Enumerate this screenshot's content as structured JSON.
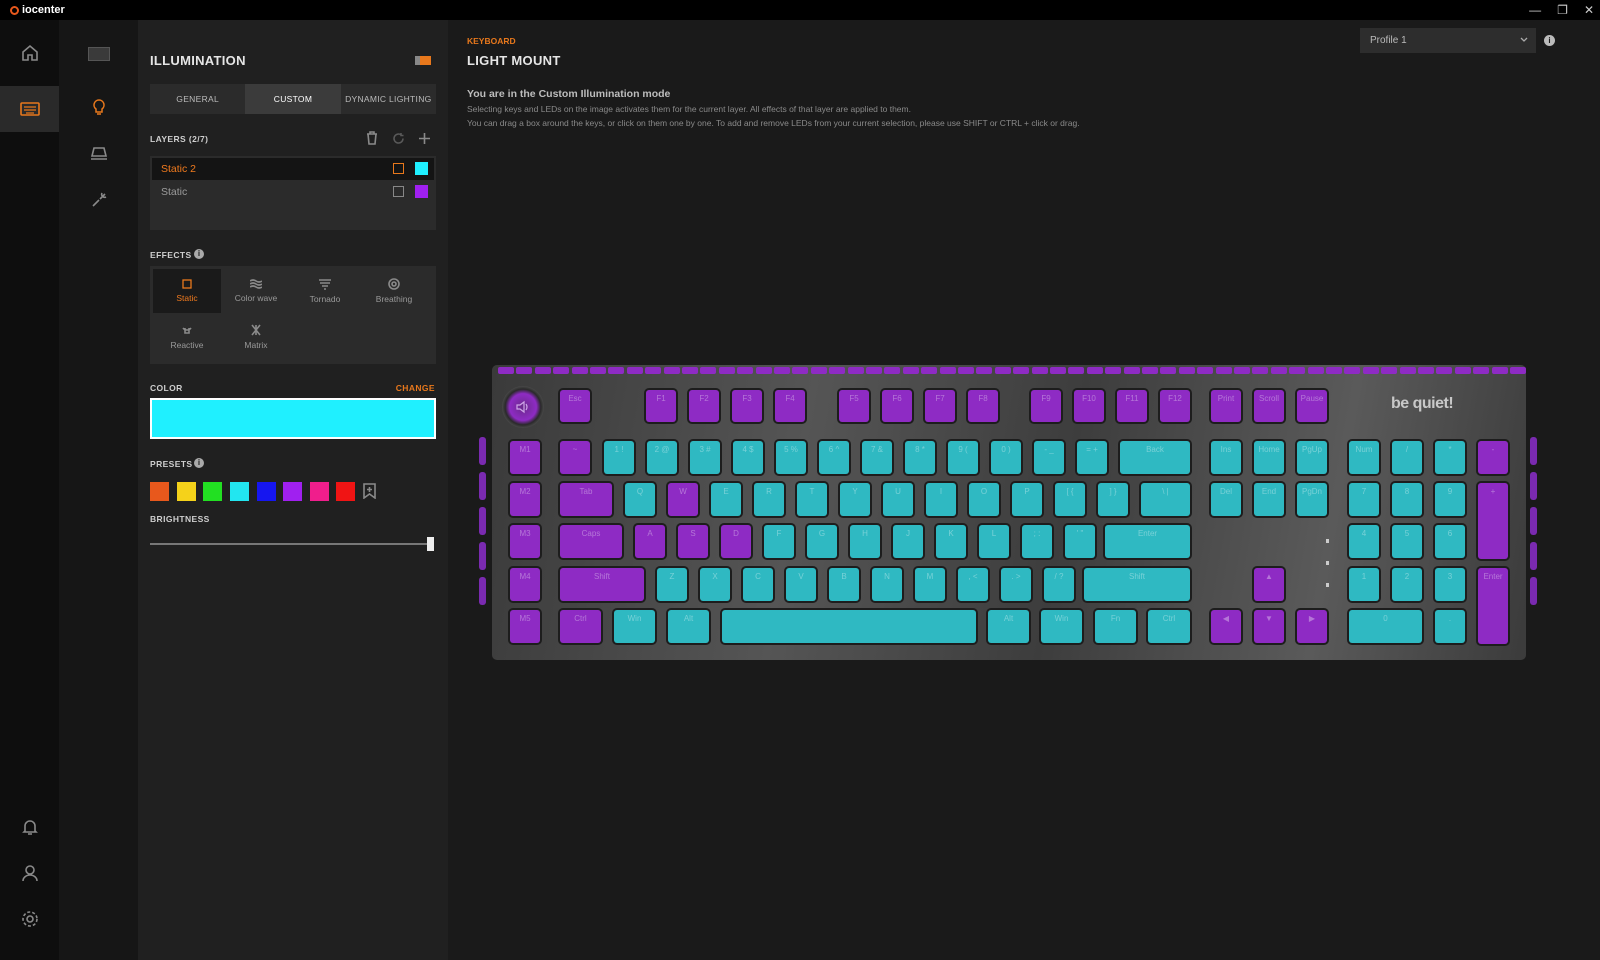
{
  "app": {
    "name": "iocenter"
  },
  "window_controls": {
    "minimize": "—",
    "restore": "❐",
    "close": "✕"
  },
  "panel": {
    "title": "ILLUMINATION",
    "tabs": [
      {
        "label": "GENERAL"
      },
      {
        "label": "CUSTOM"
      },
      {
        "label": "DYNAMIC LIGHTING"
      }
    ],
    "layers_label": "LAYERS (2/7)",
    "layers": [
      {
        "name": "Static 2",
        "color": "#1ff0ff"
      },
      {
        "name": "Static",
        "color": "#a020f0"
      }
    ],
    "effects_label": "EFFECTS",
    "effects": [
      {
        "label": "Static"
      },
      {
        "label": "Color wave"
      },
      {
        "label": "Tornado"
      },
      {
        "label": "Breathing"
      },
      {
        "label": "Reactive"
      },
      {
        "label": "Matrix"
      }
    ],
    "color_label": "COLOR",
    "change_label": "CHANGE",
    "current_color": "#1ff0ff",
    "presets_label": "PRESETS",
    "presets": [
      "#e8581c",
      "#f5d21a",
      "#22e022",
      "#22e6f0",
      "#1616f0",
      "#a020f0",
      "#f01e8c",
      "#f01414"
    ],
    "brightness_label": "BRIGHTNESS",
    "brightness": 1.0
  },
  "main": {
    "breadcrumb": "KEYBOARD",
    "title": "LIGHT MOUNT",
    "profile": "Profile 1",
    "info_heading": "You are in the Custom Illumination mode",
    "info_line1": "Selecting keys and LEDs on the image activates them for the current layer. All effects of that layer are applied to them.",
    "info_line2": "You can drag a box around the keys, or click on them one by one. To add and remove LEDs from your current selection, please use SHIFT or CTRL + click or drag."
  },
  "keyboard": {
    "brand": "be quiet!",
    "colors": {
      "cyan": "#2fb9c2",
      "purple": "#8e2bc4"
    },
    "keys": [
      {
        "l": "Esc",
        "c": "p"
      },
      {
        "l": "F1",
        "c": "p"
      },
      {
        "l": "F2",
        "c": "p"
      },
      {
        "l": "F3",
        "c": "p"
      },
      {
        "l": "F4",
        "c": "p"
      },
      {
        "l": "F5",
        "c": "p"
      },
      {
        "l": "F6",
        "c": "p"
      },
      {
        "l": "F7",
        "c": "p"
      },
      {
        "l": "F8",
        "c": "p"
      },
      {
        "l": "F9",
        "c": "p"
      },
      {
        "l": "F10",
        "c": "p"
      },
      {
        "l": "F11",
        "c": "p"
      },
      {
        "l": "F12",
        "c": "p"
      },
      {
        "l": "Print",
        "c": "p"
      },
      {
        "l": "Scroll",
        "c": "p"
      },
      {
        "l": "Pause",
        "c": "p"
      },
      {
        "l": "M1",
        "c": "p"
      },
      {
        "l": "~",
        "c": "p"
      },
      {
        "l": "1 !",
        "c": "c"
      },
      {
        "l": "2 @",
        "c": "c"
      },
      {
        "l": "3 #",
        "c": "c"
      },
      {
        "l": "4 $",
        "c": "c"
      },
      {
        "l": "5 %",
        "c": "c"
      },
      {
        "l": "6 ^",
        "c": "c"
      },
      {
        "l": "7 &",
        "c": "c"
      },
      {
        "l": "8 *",
        "c": "c"
      },
      {
        "l": "9 (",
        "c": "c"
      },
      {
        "l": "0 )",
        "c": "c"
      },
      {
        "l": "- _",
        "c": "c"
      },
      {
        "l": "= +",
        "c": "c"
      },
      {
        "l": "Back",
        "c": "c"
      },
      {
        "l": "Ins",
        "c": "c"
      },
      {
        "l": "Home",
        "c": "c"
      },
      {
        "l": "PgUp",
        "c": "c"
      },
      {
        "l": "Num",
        "c": "c"
      },
      {
        "l": "/",
        "c": "c"
      },
      {
        "l": "*",
        "c": "c"
      },
      {
        "l": "-",
        "c": "p"
      },
      {
        "l": "M2",
        "c": "p"
      },
      {
        "l": "Tab",
        "c": "p"
      },
      {
        "l": "Q",
        "c": "c"
      },
      {
        "l": "W",
        "c": "p"
      },
      {
        "l": "E",
        "c": "c"
      },
      {
        "l": "R",
        "c": "c"
      },
      {
        "l": "T",
        "c": "c"
      },
      {
        "l": "Y",
        "c": "c"
      },
      {
        "l": "U",
        "c": "c"
      },
      {
        "l": "I",
        "c": "c"
      },
      {
        "l": "O",
        "c": "c"
      },
      {
        "l": "P",
        "c": "c"
      },
      {
        "l": "[ {",
        "c": "c"
      },
      {
        "l": "] }",
        "c": "c"
      },
      {
        "l": "\\ |",
        "c": "c"
      },
      {
        "l": "Del",
        "c": "c"
      },
      {
        "l": "End",
        "c": "c"
      },
      {
        "l": "PgDn",
        "c": "c"
      },
      {
        "l": "7",
        "c": "c"
      },
      {
        "l": "8",
        "c": "c"
      },
      {
        "l": "9",
        "c": "c"
      },
      {
        "l": "+",
        "c": "p"
      },
      {
        "l": "M3",
        "c": "p"
      },
      {
        "l": "Caps",
        "c": "p"
      },
      {
        "l": "A",
        "c": "p"
      },
      {
        "l": "S",
        "c": "p"
      },
      {
        "l": "D",
        "c": "p"
      },
      {
        "l": "F",
        "c": "c"
      },
      {
        "l": "G",
        "c": "c"
      },
      {
        "l": "H",
        "c": "c"
      },
      {
        "l": "J",
        "c": "c"
      },
      {
        "l": "K",
        "c": "c"
      },
      {
        "l": "L",
        "c": "c"
      },
      {
        "l": "; :",
        "c": "c"
      },
      {
        "l": "' \"",
        "c": "c"
      },
      {
        "l": "Enter",
        "c": "c"
      },
      {
        "l": "4",
        "c": "c"
      },
      {
        "l": "5",
        "c": "c"
      },
      {
        "l": "6",
        "c": "c"
      },
      {
        "l": "M4",
        "c": "p"
      },
      {
        "l": "Shift",
        "c": "p"
      },
      {
        "l": "Z",
        "c": "c"
      },
      {
        "l": "X",
        "c": "c"
      },
      {
        "l": "C",
        "c": "c"
      },
      {
        "l": "V",
        "c": "c"
      },
      {
        "l": "B",
        "c": "c"
      },
      {
        "l": "N",
        "c": "c"
      },
      {
        "l": "M",
        "c": "c"
      },
      {
        "l": ", <",
        "c": "c"
      },
      {
        "l": ". >",
        "c": "c"
      },
      {
        "l": "/ ?",
        "c": "c"
      },
      {
        "l": "Shift",
        "c": "c"
      },
      {
        "l": "▲",
        "c": "p"
      },
      {
        "l": "1",
        "c": "c"
      },
      {
        "l": "2",
        "c": "c"
      },
      {
        "l": "3",
        "c": "c"
      },
      {
        "l": "Enter",
        "c": "p"
      },
      {
        "l": "M5",
        "c": "p"
      },
      {
        "l": "Ctrl",
        "c": "p"
      },
      {
        "l": "Win",
        "c": "c"
      },
      {
        "l": "Alt",
        "c": "c"
      },
      {
        "l": "",
        "c": "c"
      },
      {
        "l": "Alt",
        "c": "c"
      },
      {
        "l": "Win",
        "c": "c"
      },
      {
        "l": "Fn",
        "c": "c"
      },
      {
        "l": "Ctrl",
        "c": "c"
      },
      {
        "l": "◀",
        "c": "p"
      },
      {
        "l": "▼",
        "c": "p"
      },
      {
        "l": "▶",
        "c": "p"
      },
      {
        "l": "0",
        "c": "c"
      },
      {
        "l": ".",
        "c": "c"
      }
    ]
  }
}
